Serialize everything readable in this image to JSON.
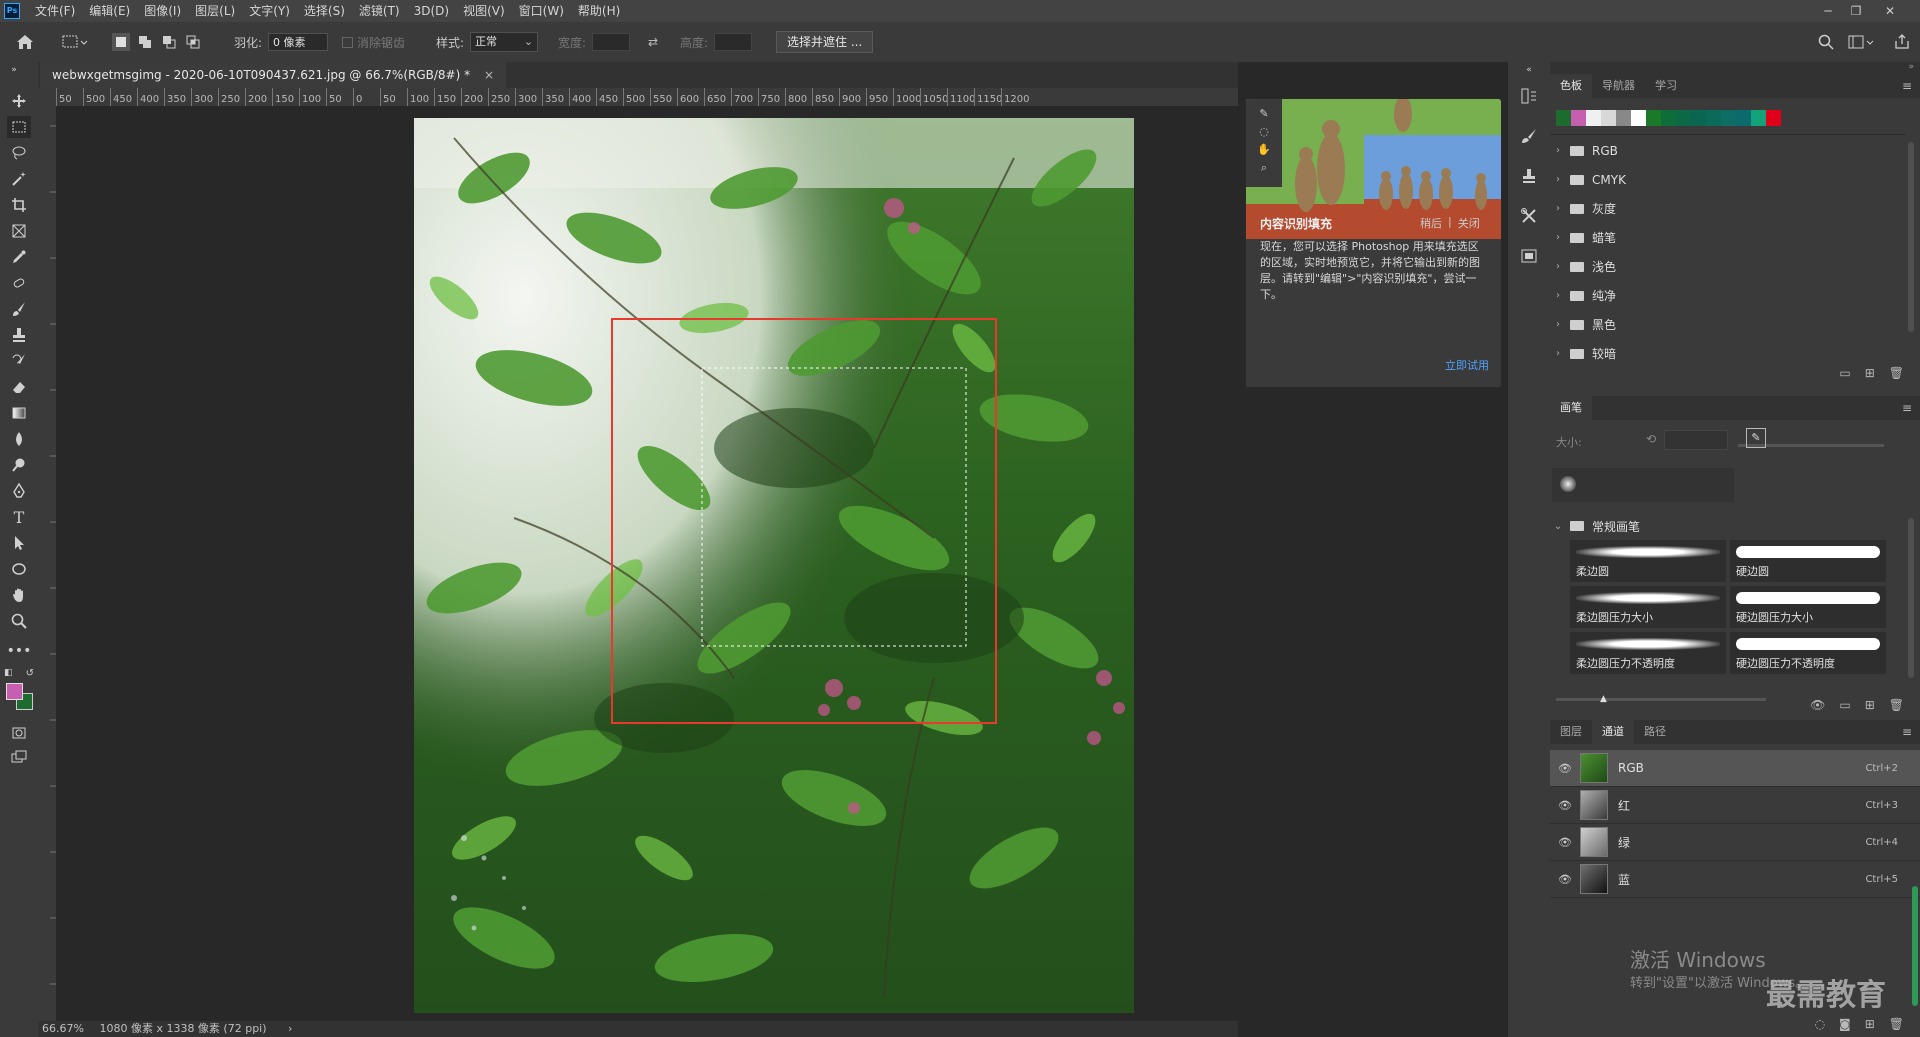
{
  "menubar": {
    "app_icon": "Ps",
    "items": [
      "文件(F)",
      "编辑(E)",
      "图像(I)",
      "图层(L)",
      "文字(Y)",
      "选择(S)",
      "滤镜(T)",
      "3D(D)",
      "视图(V)",
      "窗口(W)",
      "帮助(H)"
    ],
    "window_controls": [
      "minimize-icon",
      "restore-icon",
      "close-icon"
    ]
  },
  "options": {
    "feather_label": "羽化:",
    "feather_value": "0 像素",
    "antialias_label": "消除锯齿",
    "style_label": "样式:",
    "style_value": "正常",
    "width_label": "宽度:",
    "height_label": "高度:",
    "select_mask_button": "选择并遮住 ..."
  },
  "document": {
    "tab_title": "webwxgetmsgimg - 2020-06-10T090437.621.jpg @ 66.7%(RGB/8#) *",
    "tab_close": "×",
    "ruler_ticks": [
      "50",
      "500",
      "450",
      "400",
      "350",
      "300",
      "250",
      "200",
      "150",
      "100",
      "50",
      "0",
      "50",
      "100",
      "150",
      "200",
      "250",
      "300",
      "350",
      "400",
      "450",
      "500",
      "550",
      "600",
      "650",
      "700",
      "750",
      "800",
      "850",
      "900",
      "950",
      "1000",
      "1050",
      "1100",
      "1150",
      "1200"
    ],
    "zoom": "66.67%",
    "dimensions": "1080 像素 x 1338 像素 (72 ppi)",
    "status_arrow": "›"
  },
  "content_aware_tip": {
    "title": "内容识别填充",
    "later": "稍后",
    "close": "关闭",
    "separator": "|",
    "body": "现在，您可以选择 Photoshop 用来填充选区的区域，实时地预览它，并将它输出到新的图层。请转到\"编辑\">\"内容识别填充\"，尝试一下。",
    "try_now": "立即试用"
  },
  "swatches_panel": {
    "tabs": [
      "色板",
      "导航器",
      "学习"
    ],
    "colors": [
      "#1e6b2f",
      "#c65fb0",
      "#f0f0f0",
      "#d8d8d8",
      "#888888",
      "#ffffff",
      "#1a7a2a",
      "#0d6e3a",
      "#0b6a45",
      "#0a6650",
      "#0c6a5a",
      "#0e6e66",
      "#0a6a6e",
      "#13a37a",
      "#e0001a"
    ],
    "folders": [
      "RGB",
      "CMYK",
      "灰度",
      "蜡笔",
      "浅色",
      "纯净",
      "黑色",
      "较暗"
    ]
  },
  "brushes_panel": {
    "tab": "画笔",
    "size_label": "大小:",
    "group_name": "常规画笔",
    "brushes": [
      "柔边圆",
      "硬边圆",
      "柔边圆压力大小",
      "硬边圆压力大小",
      "柔边圆压力不透明度",
      "硬边圆压力不透明度"
    ]
  },
  "channels_panel": {
    "tabs": [
      "图层",
      "通道",
      "路径"
    ],
    "channels": [
      {
        "name": "RGB",
        "shortcut": "Ctrl+2"
      },
      {
        "name": "红",
        "shortcut": "Ctrl+3"
      },
      {
        "name": "绿",
        "shortcut": "Ctrl+4"
      },
      {
        "name": "蓝",
        "shortcut": "Ctrl+5"
      }
    ]
  },
  "watermark": {
    "activate_title": "激活 Windows",
    "activate_sub": "转到\"设置\"以激活 Windows。",
    "brand": "最需教育"
  }
}
